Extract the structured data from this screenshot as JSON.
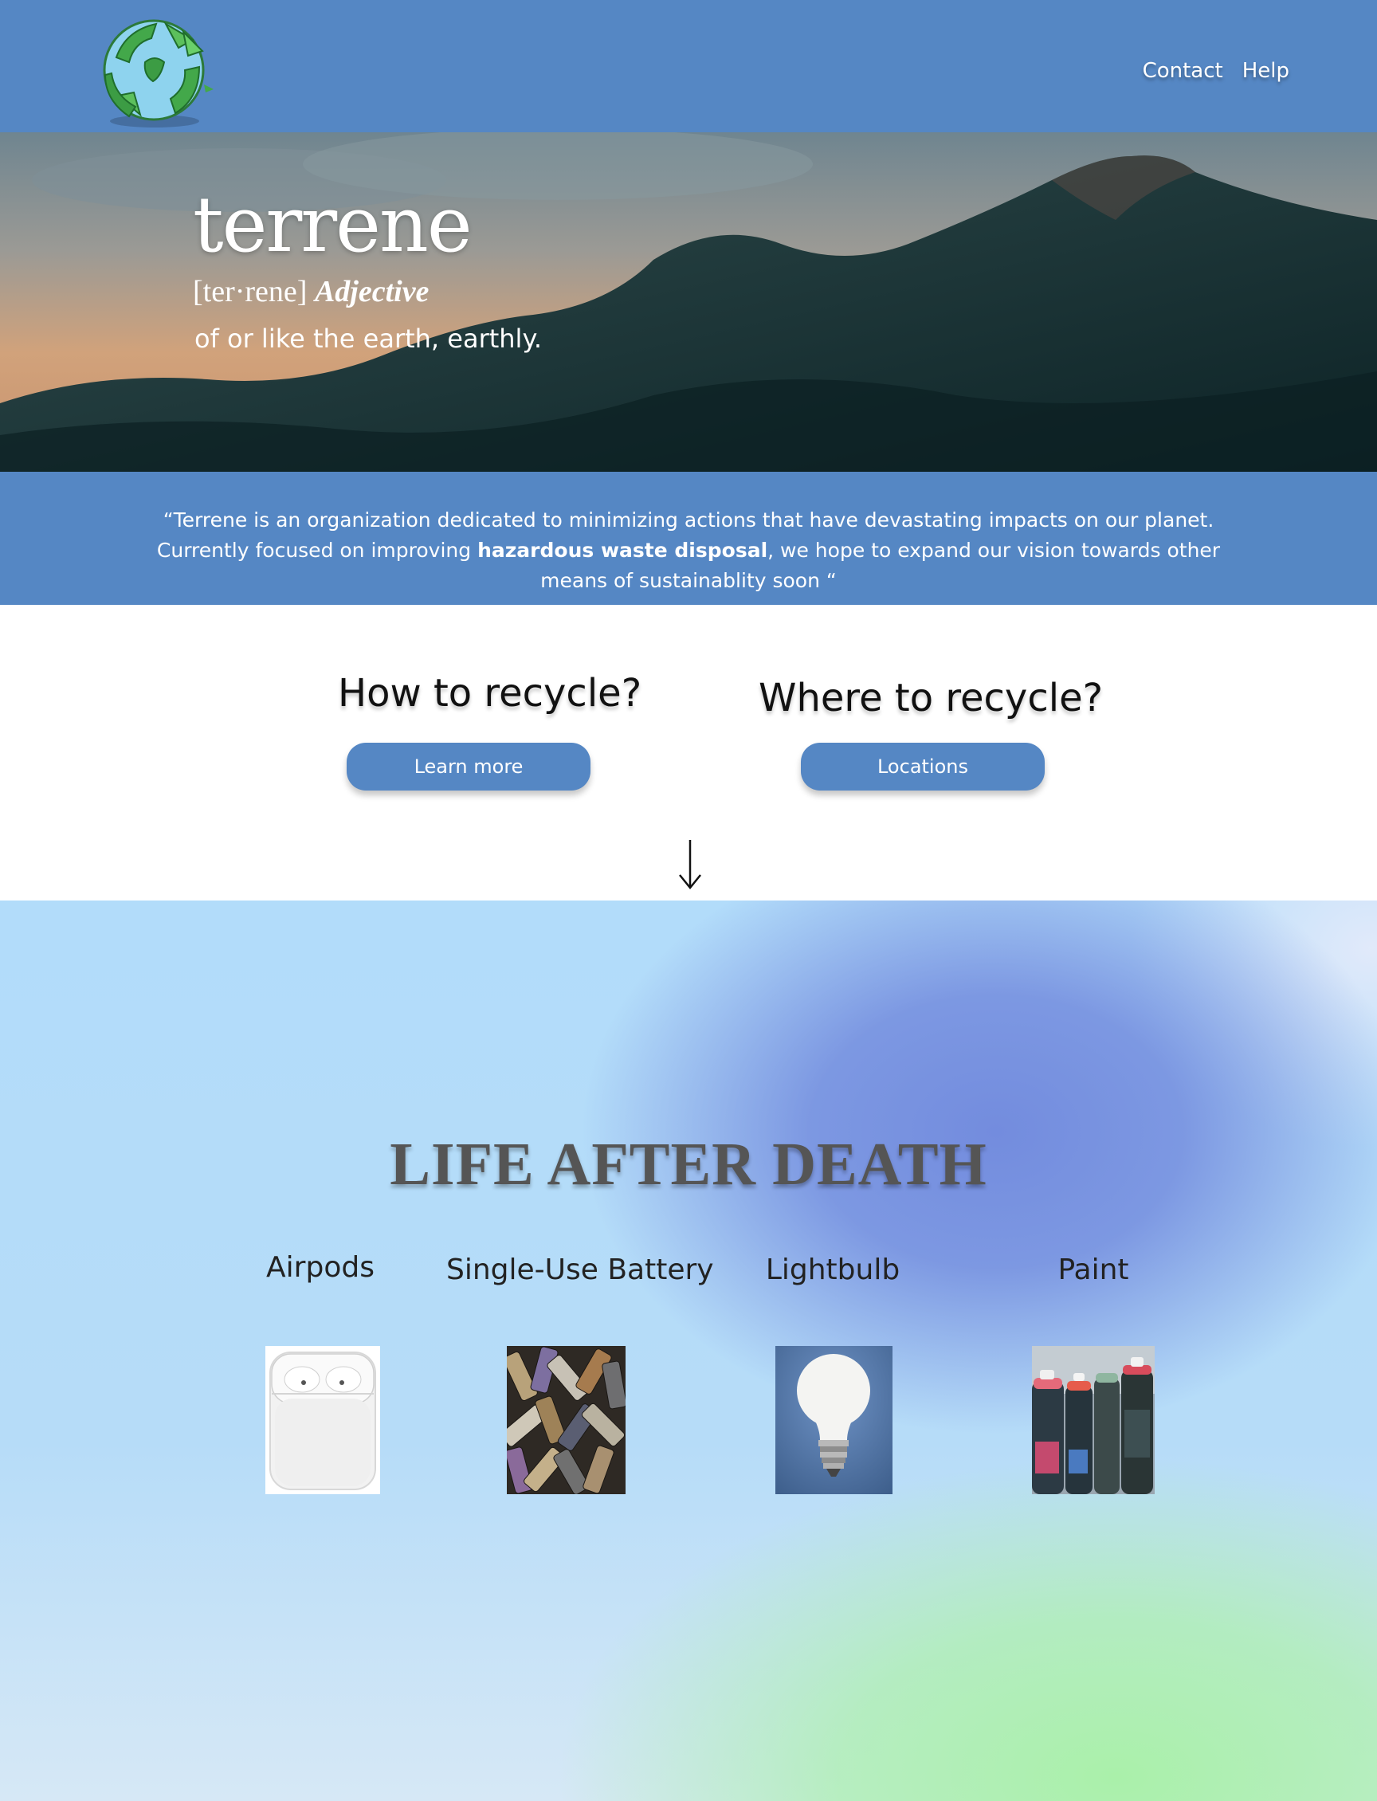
{
  "header": {
    "nav": [
      {
        "label": "Contact"
      },
      {
        "label": "Help"
      }
    ]
  },
  "hero": {
    "word": "terrene",
    "pronunciation": "[ter·rene]",
    "part_of_speech": "Adjective",
    "definition": "of or like the earth, earthly."
  },
  "mission": {
    "text_before": "“Terrene is an organization dedicated to minimizing actions that have devastating impacts on our planet. Currently focused on improving ",
    "bold": "hazardous waste disposal",
    "text_after": ", we hope to expand our vision towards other means of sustainablity soon “"
  },
  "cta": {
    "how": {
      "heading": "How to recycle?",
      "button": "Learn more"
    },
    "where": {
      "heading": "Where to recycle?",
      "button": "Locations"
    },
    "scroll_icon": "down-arrow-icon"
  },
  "life": {
    "title": "LIFE AFTER DEATH",
    "items": [
      {
        "label": "Airpods",
        "image": "airpods-case-image"
      },
      {
        "label": "Single-Use Battery",
        "image": "batteries-pile-image"
      },
      {
        "label": "Lightbulb",
        "image": "lightbulb-image"
      },
      {
        "label": "Paint",
        "image": "spray-paint-cans-image"
      }
    ]
  },
  "colors": {
    "brand_blue": "#5587c4",
    "text_dark": "#111111",
    "title_gray": "#555555"
  }
}
